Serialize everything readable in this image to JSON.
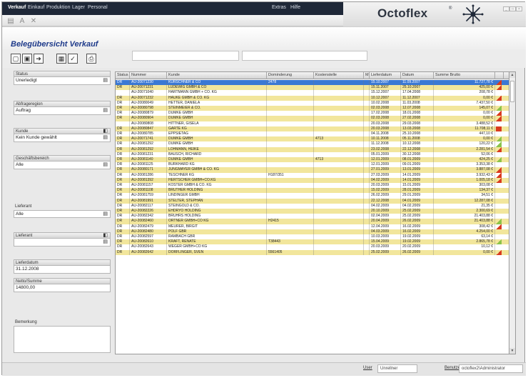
{
  "menu": {
    "items": [
      "Verkauf",
      "Einkauf",
      "Produktion",
      "Lager",
      "Personal"
    ],
    "right_items": [
      "Extras",
      "Hilfe"
    ]
  },
  "logo": {
    "text": "Octoflex",
    "sup": "®"
  },
  "toolbar1": {
    "icons": [
      "dropdown-icon",
      "font-size-icon",
      "close-x-icon"
    ]
  },
  "page": {
    "title": "Belegübersicht Verkauf"
  },
  "toolbar2": {
    "icons": [
      "new-doc-icon",
      "copy-doc-icon",
      "export-icon",
      "print-preview-icon",
      "check-icon",
      "printer-icon"
    ]
  },
  "sidebar": {
    "status": {
      "label": "Status",
      "value": "Unerledigt"
    },
    "type": {
      "label": "Abfrageregion",
      "value": "Auftrag"
    },
    "customer": {
      "label": "Kunde",
      "value": "Kein Kunde gewählt"
    },
    "area": {
      "label": "Geschäftsbereich",
      "value": "Alle"
    },
    "sales_rep": {
      "label": "Lieferant",
      "value": "Alle"
    },
    "contact": {
      "label": "Lieferant",
      "value": ""
    },
    "delivery_date": {
      "label": "Lieferdatum",
      "value": "31.12.2008"
    },
    "net_total": {
      "label": "Netto/Summe",
      "value": "14800,00"
    },
    "remark": {
      "label": "Bemerkung"
    }
  },
  "grid": {
    "headers": [
      "Status",
      "Nummer",
      "Kunde",
      "Dominderung",
      "Kostenstelle",
      "M",
      "Lieferdatum",
      "Datum",
      "Summe Brutto",
      ""
    ],
    "rows": [
      {
        "style": "sel",
        "status": "DR",
        "number": "AU-20071230",
        "customer": "KÜRSCHNER & CO",
        "ref": "2478",
        "cost": "",
        "delivery": "15.10.2007",
        "date": "11.09.2007",
        "sum": "11.727,78 €",
        "flag": "red"
      },
      {
        "style": "yellow",
        "status": "DR",
        "number": "AU-20071231",
        "customer": "LUDEWIG GMBH & CO",
        "ref": "",
        "cost": "",
        "delivery": "15.11.2007",
        "date": "25.10.2007",
        "sum": "425,00 €",
        "flag": "red"
      },
      {
        "style": "white",
        "status": "",
        "number": "AU-20071040",
        "customer": "HARTMANN GMBH + CO. KG",
        "ref": "",
        "cost": "",
        "delivery": "15.12.2007",
        "date": "17.04.2008",
        "sum": "208,78 €",
        "flag": ""
      },
      {
        "style": "yellow",
        "status": "DR",
        "number": "AU-20071232",
        "customer": "HAUKE GMBH & CO. KG",
        "ref": "",
        "cost": "",
        "delivery": "10.12.2007",
        "date": "11.12.2007",
        "sum": "0,00 €",
        "flag": "red"
      },
      {
        "style": "white",
        "status": "DR",
        "number": "AU-20080049",
        "customer": "HETTER, DANIELA",
        "ref": "",
        "cost": "",
        "delivery": "10.02.2008",
        "date": "11.03.2008",
        "sum": "7.437,50 €",
        "flag": ""
      },
      {
        "style": "yellow",
        "status": "DR",
        "number": "AU-20080798",
        "customer": "STEINMEIER & CO.",
        "ref": "",
        "cost": "",
        "delivery": "02.03.2008",
        "date": "12.07.2008",
        "sum": "145,07 €",
        "flag": "green"
      },
      {
        "style": "white",
        "status": "DR",
        "number": "AU-20080879",
        "customer": "DUMKE GMBH",
        "ref": "",
        "cost": "",
        "delivery": "17.02.2008",
        "date": "18.01.2008",
        "sum": "0,00 €",
        "flag": "red"
      },
      {
        "style": "yellow",
        "status": "DR",
        "number": "AU-20080904",
        "customer": "DUMKE GMBH",
        "ref": "",
        "cost": "",
        "delivery": "02.03.2008",
        "date": "27.02.2008",
        "sum": "0,00 €",
        "flag": "red"
      },
      {
        "style": "white",
        "status": "",
        "number": "AU-20080808",
        "customer": "HITTNER, GISELA",
        "ref": "",
        "cost": "",
        "delivery": "20.03.2008",
        "date": "29.03.2008",
        "sum": "3.488,52 €",
        "flag": ""
      },
      {
        "style": "yellow",
        "status": "DR",
        "number": "AU-20080847",
        "customer": "GARTE KG",
        "ref": "",
        "cost": "",
        "delivery": "20.03.2008",
        "date": "13.03.2008",
        "sum": "11.708,11 €",
        "flag": "redfull"
      },
      {
        "style": "white",
        "status": "DR",
        "number": "AU-20080785",
        "customer": "EPPSIETAG",
        "ref": "",
        "cost": "",
        "delivery": "04.11.2008",
        "date": "25.10.2008",
        "sum": "447,10 €",
        "flag": ""
      },
      {
        "style": "yellow",
        "status": "DR",
        "number": "AU-20071741",
        "customer": "DUMKE GMBH",
        "ref": "",
        "cost": "4713",
        "delivery": "10.11.2008",
        "date": "05.11.2008",
        "sum": "0,00 €",
        "flag": "green"
      },
      {
        "style": "white",
        "status": "DR",
        "number": "AU-20081292",
        "customer": "DUMKE GMBH",
        "ref": "",
        "cost": "",
        "delivery": "11.12.2008",
        "date": "10.12.2008",
        "sum": "120,22 €",
        "flag": "green"
      },
      {
        "style": "yellow",
        "status": "DR",
        "number": "AU-20081292",
        "customer": "LOHMANN, HEIKE",
        "ref": "",
        "cost": "",
        "delivery": "23.02.2008",
        "date": "22.12.2008",
        "sum": "2.281,54 €",
        "flag": "red"
      },
      {
        "style": "white",
        "status": "DR",
        "number": "AU-20081231",
        "customer": "BAUSCH, RICHARD",
        "ref": "",
        "cost": "",
        "delivery": "05.01.2009",
        "date": "30.12.2008",
        "sum": "52,06 €",
        "flag": ""
      },
      {
        "style": "yellow",
        "status": "DR",
        "number": "AU-20081140",
        "customer": "DUMKE GMBH",
        "ref": "",
        "cost": "4713",
        "delivery": "12.01.2009",
        "date": "08.01.2009",
        "sum": "424,25 €",
        "flag": "green"
      },
      {
        "style": "white",
        "status": "DR",
        "number": "AU-20081125",
        "customer": "BURKHARD KG",
        "ref": "",
        "cost": "",
        "delivery": "12.01.2009",
        "date": "09.01.2009",
        "sum": "3.353,38 €",
        "flag": ""
      },
      {
        "style": "yellow",
        "status": "DR",
        "number": "AU-20080171",
        "customer": "JUNGMAYER GMBH & CO. KG",
        "ref": "",
        "cost": "",
        "delivery": "27.01.2009",
        "date": "13.01.2009",
        "sum": "3.887,08 €",
        "flag": "red"
      },
      {
        "style": "white",
        "status": "DR",
        "number": "AU-20081286",
        "customer": "TESCHNER KG",
        "ref": "H187/351",
        "cost": "",
        "delivery": "27.03.2009",
        "date": "14.01.2009",
        "sum": "3.932,43 €",
        "flag": "red"
      },
      {
        "style": "yellow",
        "status": "DR",
        "number": "AU-20081392",
        "customer": "HERTSCHER GMBH+CO.KG",
        "ref": "",
        "cost": "",
        "delivery": "04.02.2009",
        "date": "14.01.2009",
        "sum": "1.005,18 €",
        "flag": "red"
      },
      {
        "style": "white",
        "status": "DR",
        "number": "AU-20081157",
        "customer": "KÖSTER GMBH & CO. KG",
        "ref": "",
        "cost": "",
        "delivery": "20.03.2009",
        "date": "15.01.2009",
        "sum": "303,08 €",
        "flag": ""
      },
      {
        "style": "yellow",
        "status": "DR",
        "number": "AU-20081108",
        "customer": "BRÜTHER HOLDING",
        "ref": "",
        "cost": "",
        "delivery": "15.02.2009",
        "date": "28.01.2009",
        "sum": "134,37 €",
        "flag": ""
      },
      {
        "style": "white",
        "status": "DR",
        "number": "AU-20081759",
        "customer": "LINDINGER GMBH",
        "ref": "",
        "cost": "",
        "delivery": "26.02.2009",
        "date": "29.01.2009",
        "sum": "34,51 €",
        "flag": ""
      },
      {
        "style": "yellow",
        "status": "DR",
        "number": "AU-20081991",
        "customer": "STELTER, STEPHAN",
        "ref": "",
        "cost": "",
        "delivery": "22.12.2008",
        "date": "04.01.2009",
        "sum": "12.287,08 €",
        "flag": ""
      },
      {
        "style": "white",
        "status": "DR",
        "number": "AU-20082117",
        "customer": "STEINGOLD & CO.",
        "ref": "",
        "cost": "",
        "delivery": "04.02.2009",
        "date": "04.02.2009",
        "sum": "21,35 €",
        "flag": ""
      },
      {
        "style": "yellow",
        "status": "DR",
        "number": "AU-20082226",
        "customer": "EHDRYO HOLDING",
        "ref": "",
        "cost": "",
        "delivery": "20.10.2009",
        "date": "25.02.2009",
        "sum": "2.300,69 €",
        "flag": ""
      },
      {
        "style": "white",
        "status": "DR",
        "number": "AU-20082342",
        "customer": "BRÜHRS HOLDING",
        "ref": "",
        "cost": "",
        "delivery": "02.04.2009",
        "date": "25.02.2009",
        "sum": "21.403,88 €",
        "flag": ""
      },
      {
        "style": "yellow",
        "status": "DR",
        "number": "AU-20082460",
        "customer": "ORTNER GMBH+CO KG",
        "ref": "H2415",
        "cost": "",
        "delivery": "20.04.2009",
        "date": "26.02.2009",
        "sum": "21.403,88 €",
        "flag": "green"
      },
      {
        "style": "white",
        "status": "DR",
        "number": "AU-20082479",
        "customer": "MEURER, BIRGIT",
        "ref": "",
        "cost": "",
        "delivery": "12.04.2009",
        "date": "16.02.2009",
        "sum": "308,42 €",
        "flag": "red"
      },
      {
        "style": "yellow",
        "status": "DR",
        "number": "AU-20082480",
        "customer": "POLF GBR",
        "ref": "",
        "cost": "",
        "delivery": "04.03.2009",
        "date": "16.02.2009",
        "sum": "4.254,00 €",
        "flag": ""
      },
      {
        "style": "white",
        "status": "DR",
        "number": "AU-20082597",
        "customer": "RAMBACH GBR",
        "ref": "",
        "cost": "",
        "delivery": "10.03.2009",
        "date": "19.02.2009",
        "sum": "63,14 €",
        "flag": ""
      },
      {
        "style": "yellow",
        "status": "DR",
        "number": "AU-20082610",
        "customer": "KRAFT, RENATE",
        "ref": "T38443",
        "cost": "",
        "delivery": "15.04.2009",
        "date": "19.02.2009",
        "sum": "2.865,78 €",
        "flag": "green"
      },
      {
        "style": "white",
        "status": "DR",
        "number": "AU-20082643",
        "customer": "WEGER GMBH+CO KG",
        "ref": "",
        "cost": "",
        "delivery": "20.03.2009",
        "date": "20.02.2009",
        "sum": "10,12 €",
        "flag": ""
      },
      {
        "style": "yellow",
        "status": "DR",
        "number": "AU-20082642",
        "customer": "DÖRFLINGER, SVEN",
        "ref": "5561405",
        "cost": "",
        "delivery": "25.02.2009",
        "date": "26.02.2009",
        "sum": "0,00 €",
        "flag": "red"
      }
    ]
  },
  "statusbar": {
    "label1": "User",
    "value1": "Unrellner",
    "label2": "Benutzer",
    "value2": "octoflex2\\Administrator"
  },
  "colors": {
    "row_yellow": "#f2e69c",
    "row_selected": "#3a78d4",
    "flag_red": "#d93a1e",
    "flag_green": "#8bc34a",
    "title_blue": "#1e3a8a",
    "menu_bg": "#1f2838"
  }
}
